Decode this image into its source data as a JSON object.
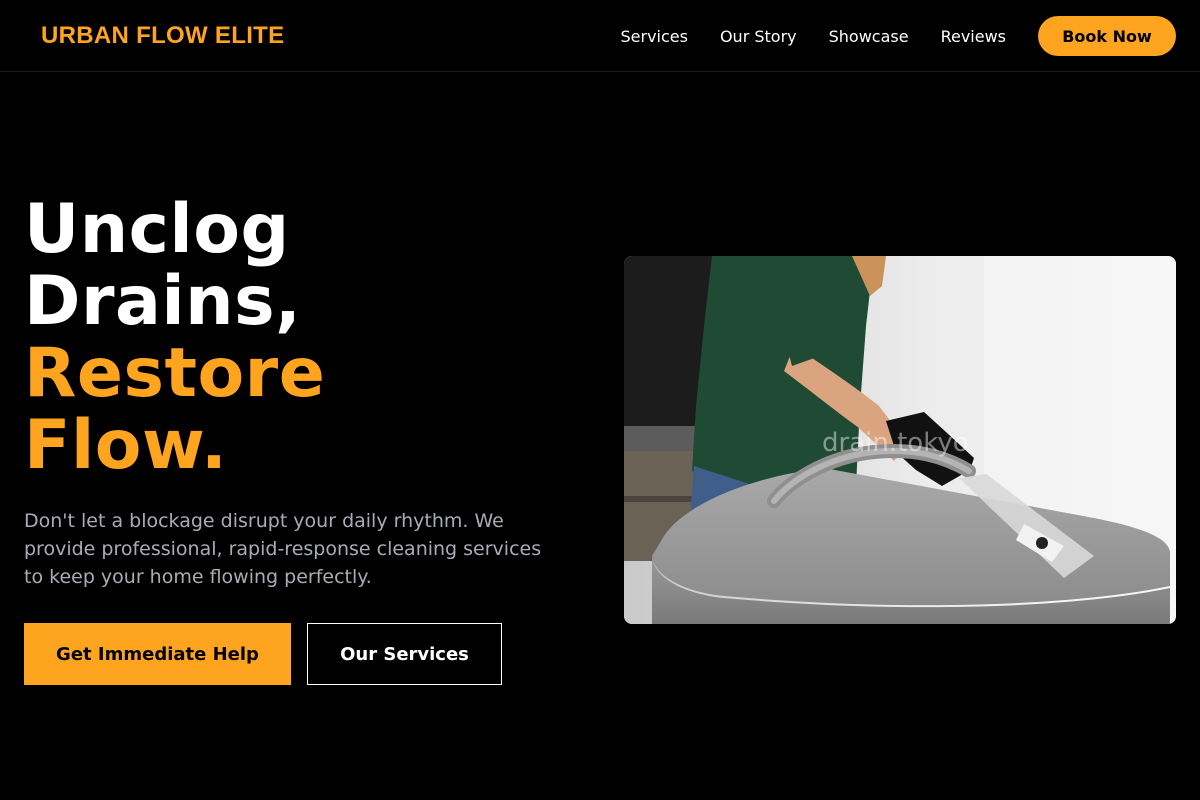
{
  "brand": {
    "name": "URBAN FLOW ELITE"
  },
  "nav": {
    "items": [
      {
        "label": "Services"
      },
      {
        "label": "Our Story"
      },
      {
        "label": "Showcase"
      },
      {
        "label": "Reviews"
      }
    ],
    "cta_label": "Book Now"
  },
  "hero": {
    "title_line1": "Unclog",
    "title_line2": "Drains,",
    "title_accent_line1": "Restore",
    "title_accent_line2": "Flow.",
    "subtitle": "Don't let a blockage disrupt your daily rhythm. We provide professional, rapid-response cleaning services to keep your home flowing perfectly.",
    "primary_button": "Get Immediate Help",
    "secondary_button": "Our Services",
    "image_watermark": "drain.tokyo"
  },
  "colors": {
    "background": "#000000",
    "accent": "#ffa41f",
    "text": "#ffffff",
    "muted_text": "#a9acb4"
  }
}
